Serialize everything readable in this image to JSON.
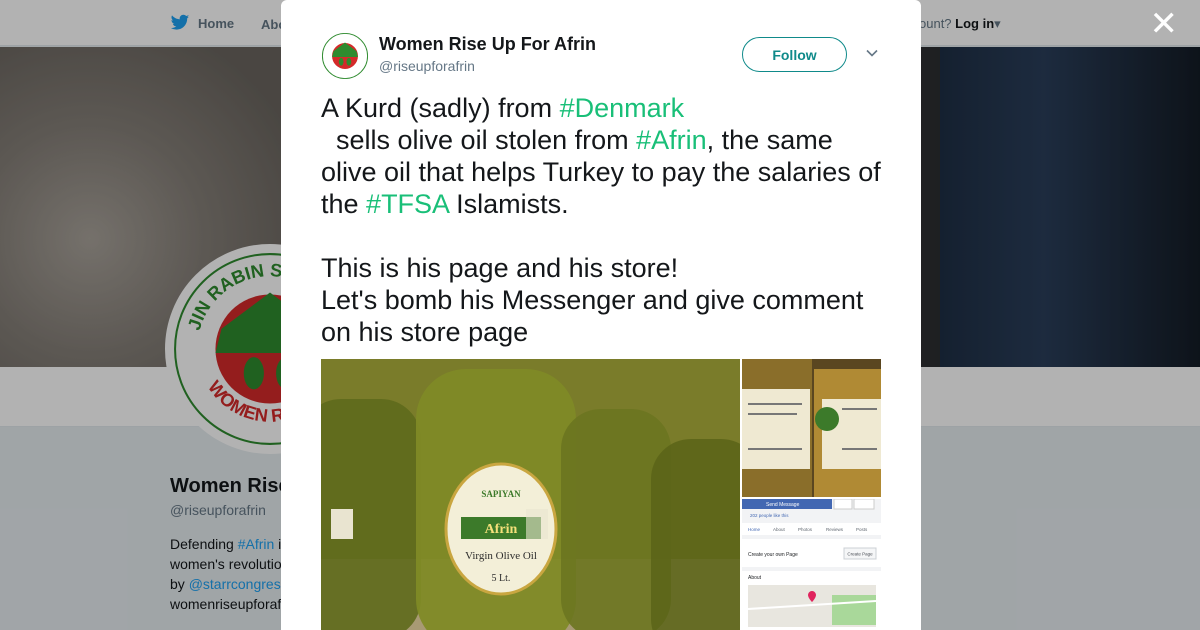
{
  "nav": {
    "home_label": "Home",
    "about_label": "Abo",
    "account_prefix": "ccount?",
    "login_label": "Log in"
  },
  "profile": {
    "name": "Women Rise",
    "handle": "@riseupforafrin",
    "bio_line1_prefix": "Defending ",
    "bio_line1_link": "#Afrin",
    "bio_line1_suffix": " i",
    "bio_line2": "women's revolutio",
    "bio_line3_prefix": "by ",
    "bio_line3_link": "@starrcongres",
    "bio_line4": "womenriseupforaf"
  },
  "tweet": {
    "author_name": "Women Rise Up For Afrin",
    "author_handle": "@riseupforafrin",
    "follow_label": "Follow",
    "line1_a": "A Kurd (sadly) from ",
    "tag_denmark": "#Denmark",
    "line1_b": "  sells olive oil stolen from ",
    "tag_afrin": "#Afrin",
    "line1_c": ", the same olive oil that helps Turkey to pay the salaries of the ",
    "tag_tfsa": "#TFSA",
    "line1_d": " Islamists.",
    "line2": "This is his page and his store!",
    "line3": "Let's bomb his Messenger and give comment on his store page"
  },
  "media": {
    "label_brand": "SAPIYAN",
    "label_afrin": "Afrin",
    "label_product": "Virgin Olive Oil",
    "label_size": "5 Lt.",
    "fb_send": "Send Message",
    "fb_likes": "202 people like this",
    "fb_tabs": [
      "Home",
      "About",
      "Photos",
      "Reviews",
      "Posts"
    ],
    "fb_create": "Create your own Page",
    "fb_create_btn": "Create Page",
    "fb_about": "About"
  },
  "logo": {
    "arc_top": "JIN RABIN SER PIYAN",
    "arc_bottom": "WOMEN RISE UP"
  },
  "colors": {
    "hashtag": "#19bf78",
    "link": "#1da1f2",
    "follow": "#0f8a8a",
    "logo_red": "#d42a2a",
    "logo_green": "#2f8b2f"
  },
  "icons": {
    "home": "twitter-bird-icon",
    "close": "close-icon",
    "caret": "chevron-down-icon"
  },
  "close_glyph": "✕"
}
